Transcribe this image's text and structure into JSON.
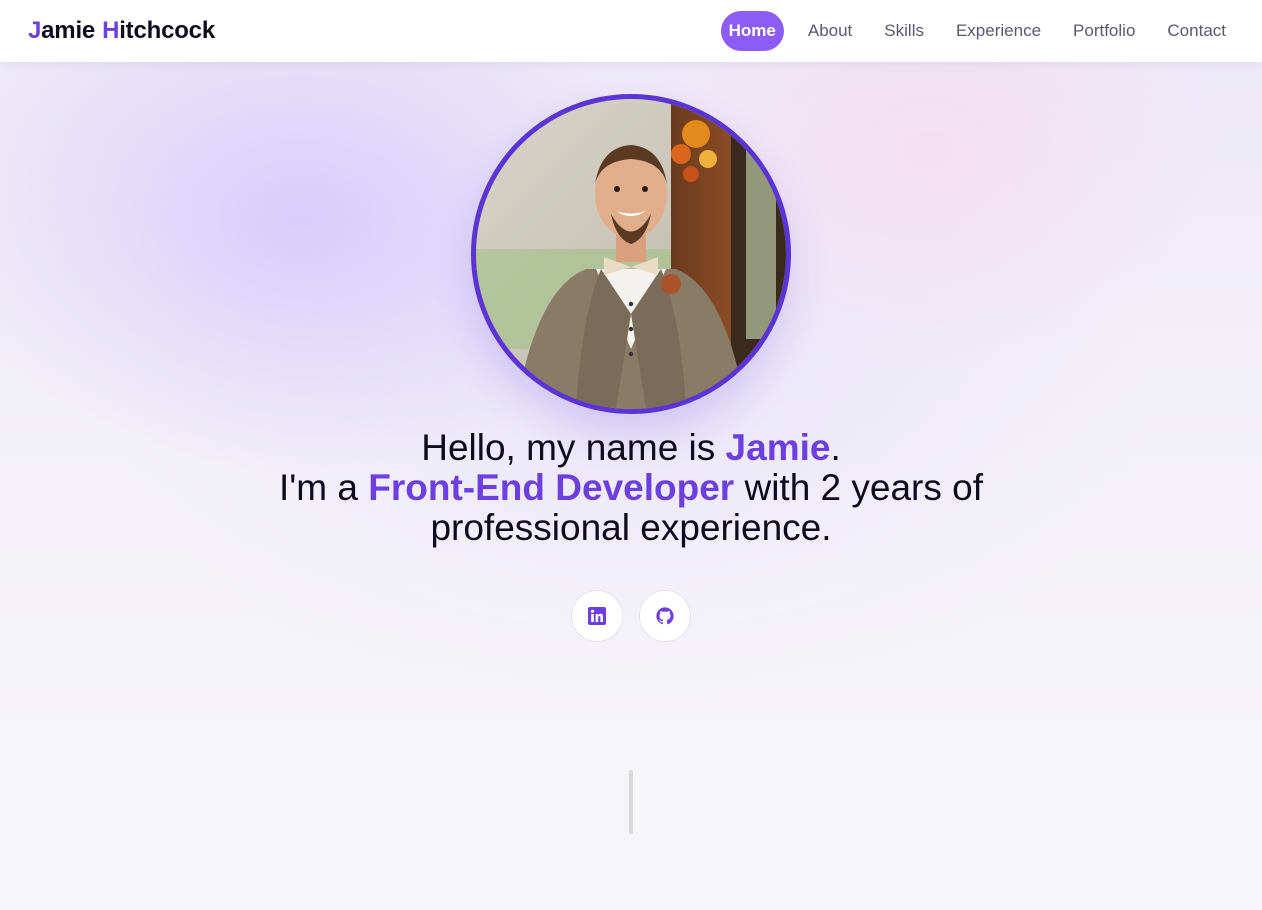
{
  "brand": {
    "first_initial": "J",
    "first_rest": "amie",
    "last_initial": "H",
    "last_rest": "itchcock",
    "accent_color": "#6d3fe0"
  },
  "nav": {
    "items": [
      {
        "label": "Home",
        "active": true
      },
      {
        "label": "About",
        "active": false
      },
      {
        "label": "Skills",
        "active": false
      },
      {
        "label": "Experience",
        "active": false
      },
      {
        "label": "Portfolio",
        "active": false
      },
      {
        "label": "Contact",
        "active": false
      }
    ],
    "active_color": "#8b5cf6"
  },
  "hero": {
    "line1_prefix": "Hello, my name is ",
    "line1_name": "Jamie",
    "line1_suffix": ".",
    "line2_prefix": "I'm a ",
    "line2_role": "Front-End Developer",
    "line2_suffix": " with 2 years of professional experience.",
    "avatar_icon": "profile-photo"
  },
  "socials": [
    {
      "icon": "linkedin-icon"
    },
    {
      "icon": "github-icon"
    }
  ]
}
